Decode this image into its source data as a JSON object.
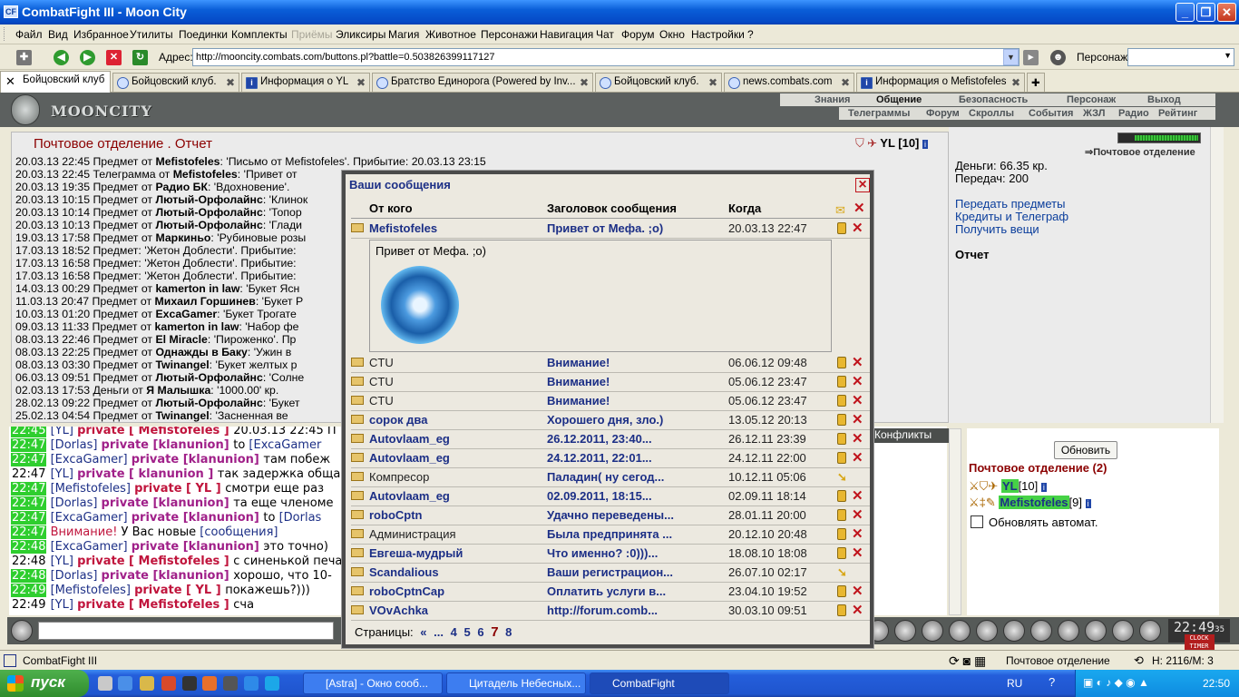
{
  "window": {
    "title": "CombatFight III - Moon City",
    "app_icon": "CF"
  },
  "menu": [
    "Файл",
    "Вид",
    "Избранное",
    "Утилиты",
    "Поединки",
    "Комплекты",
    "Приёмы",
    "Эликсиры",
    "Магия",
    "Животное",
    "Персонажи",
    "Навигация",
    "Чат",
    "Форум",
    "Окно",
    "Настройки",
    "?"
  ],
  "address": {
    "label": "Адрес:",
    "url": "http://mooncity.combats.com/buttons.pl?battle=0.503826399117127",
    "persona_label": "Персонаж:"
  },
  "tabs": [
    "Бойцовский клуб",
    "Бойцовский клуб.",
    "Информация о YL",
    "Братство Единорога (Powered by Inv...",
    "Бойцовский клуб.",
    "news.combats.com",
    "Информация о Mefistofeles"
  ],
  "game_nav": {
    "logo": "MOONCITY",
    "top": [
      "Знания",
      "Общение",
      "Безопасность",
      "Персонаж",
      "Выход"
    ],
    "bottom": [
      "Телеграммы",
      "Форум",
      "Скроллы",
      "События",
      "ЖЗЛ",
      "Радио",
      "Рейтинг"
    ]
  },
  "mail": {
    "title": "Почтовое отделение .   Отчет",
    "user": "YL [10]",
    "log": [
      {
        "pre": "20.03.13 22:45 Предмет от ",
        "who": "Mefistofeles",
        "post": ": 'Письмо от Mefistofeles'. Прибытие: 20.03.13 23:15"
      },
      {
        "pre": "20.03.13 22:45 Телеграмма от ",
        "who": "Mefistofeles",
        "post": ": 'Привет от"
      },
      {
        "pre": "20.03.13 19:35 Предмет от ",
        "who": "Радио БК",
        "post": ": 'Вдохновение'."
      },
      {
        "pre": "20.03.13 10:15 Предмет от ",
        "who": "Лютый-Орфолайнс",
        "post": ": 'Клинок"
      },
      {
        "pre": "20.03.13 10:14 Предмет от ",
        "who": "Лютый-Орфолайнс",
        "post": ": 'Топор"
      },
      {
        "pre": "20.03.13 10:13 Предмет от ",
        "who": "Лютый-Орфолайнс",
        "post": ": 'Глади"
      },
      {
        "pre": "19.03.13 17:58 Предмет от ",
        "who": "Маркиньо",
        "post": ": 'Рубиновые розы"
      },
      {
        "pre": "17.03.13 18:52 Предмет: 'Жетон Доблести'. Прибытие:",
        "who": "",
        "post": ""
      },
      {
        "pre": "17.03.13 16:58 Предмет: 'Жетон Доблести'. Прибытие:",
        "who": "",
        "post": ""
      },
      {
        "pre": "17.03.13 16:58 Предмет: 'Жетон Доблести'. Прибытие:",
        "who": "",
        "post": ""
      },
      {
        "pre": "14.03.13 00:29 Предмет от ",
        "who": "kamerton in law",
        "post": ": 'Букет Ясн"
      },
      {
        "pre": "11.03.13 20:47 Предмет от ",
        "who": "Михаил Горшинев",
        "post": ": 'Букет Р"
      },
      {
        "pre": "10.03.13 01:20 Предмет от ",
        "who": "ExcaGamer",
        "post": ": 'Букет Трогате"
      },
      {
        "pre": "09.03.13 11:33 Предмет от ",
        "who": "kamerton in law",
        "post": ": 'Набор фе"
      },
      {
        "pre": "08.03.13 22:46 Предмет от ",
        "who": "El Miracle",
        "post": ": 'Пироженко'. Пр"
      },
      {
        "pre": "08.03.13 22:25 Предмет от ",
        "who": "Однажды в Баку",
        "post": ": 'Ужин в"
      },
      {
        "pre": "08.03.13 03:30 Предмет от ",
        "who": "Twinangel",
        "post": ": 'Букет желтых р"
      },
      {
        "pre": "06.03.13 09:51 Предмет от ",
        "who": "Лютый-Орфолайнс",
        "post": ": 'Солне"
      },
      {
        "pre": "02.03.13 17:53 Деньги от ",
        "who": "Я Малышка",
        "post": ": '1000.00' кр."
      },
      {
        "pre": "28.02.13 09:22 Предмет от ",
        "who": "Лютый-Орфолайнс",
        "post": ": 'Букет"
      },
      {
        "pre": "25.02.13 04:54 Предмет от ",
        "who": "Twinangel",
        "post": ": 'Засненная ве"
      }
    ]
  },
  "right": {
    "post_link": "Почтовое отделение",
    "money": "Деньги: 66.35 кр.",
    "transfers": "Передач: 200",
    "links": [
      "Передать предметы",
      "Кредиты и Телеграф",
      "Получить вещи"
    ],
    "report": "Отчет"
  },
  "chat": [
    {
      "ts": "22:45",
      "parts": [
        [
          "nm",
          "[YL] "
        ],
        [
          "pv",
          "private [ Mefistofeles ] "
        ],
        [
          "",
          "20.03.13 22:45 П"
        ]
      ]
    },
    {
      "ts": "22:47",
      "parts": [
        [
          "nm",
          "[Dorlas] "
        ],
        [
          "kl",
          "private [klanunion] "
        ],
        [
          "",
          "to "
        ],
        [
          "nm",
          "[ExcaGamer"
        ]
      ]
    },
    {
      "ts": "22:47",
      "parts": [
        [
          "nm",
          "[ExcaGamer] "
        ],
        [
          "kl",
          "private [klanunion] "
        ],
        [
          "",
          "там побеж"
        ]
      ]
    },
    {
      "ts": "22:47",
      "plain": true,
      "parts": [
        [
          "nm",
          "[YL] "
        ],
        [
          "kl",
          "private [ klanunion ] "
        ],
        [
          "",
          "так задержка обща"
        ]
      ]
    },
    {
      "ts": "22:47",
      "parts": [
        [
          "nm",
          "[Mefistofeles] "
        ],
        [
          "pv",
          "private [ YL ] "
        ],
        [
          "",
          "смотри еще раз"
        ]
      ]
    },
    {
      "ts": "22:47",
      "parts": [
        [
          "nm",
          "[Dorlas] "
        ],
        [
          "kl",
          "private [klanunion] "
        ],
        [
          "",
          "та еще членоме"
        ]
      ]
    },
    {
      "ts": "22:47",
      "parts": [
        [
          "nm",
          "[ExcaGamer] "
        ],
        [
          "kl",
          "private [klanunion] "
        ],
        [
          "",
          "to "
        ],
        [
          "nm",
          "[Dorlas"
        ]
      ]
    },
    {
      "ts": "22:47",
      "parts": [
        [
          "warn",
          "Внимание! "
        ],
        [
          "",
          "У Вас новые "
        ],
        [
          "nm",
          "[сообщения]"
        ]
      ]
    },
    {
      "ts": "22:48",
      "parts": [
        [
          "nm",
          "[ExcaGamer] "
        ],
        [
          "kl",
          "private [klanunion] "
        ],
        [
          "",
          "это точно)"
        ]
      ]
    },
    {
      "ts": "22:48",
      "plain": true,
      "parts": [
        [
          "nm",
          "[YL] "
        ],
        [
          "pv",
          "private [ Mefistofeles ] "
        ],
        [
          "",
          "с синенькой печа"
        ]
      ]
    },
    {
      "ts": "22:48",
      "parts": [
        [
          "nm",
          "[Dorlas] "
        ],
        [
          "kl",
          "private [klanunion] "
        ],
        [
          "",
          "хорошо, что 10-"
        ]
      ]
    },
    {
      "ts": "22:49",
      "parts": [
        [
          "nm",
          "[Mefistofeles] "
        ],
        [
          "pv",
          "private [ YL ] "
        ],
        [
          "",
          "покажешь?)))"
        ]
      ]
    },
    {
      "ts": "22:49",
      "plain": true,
      "parts": [
        [
          "nm",
          "[YL] "
        ],
        [
          "pv",
          "private [ Mefistofeles ] "
        ],
        [
          "",
          "сча"
        ]
      ]
    }
  ],
  "conflicts": "Конфликты",
  "rightbottom": {
    "refresh": "Обновить",
    "title": "Почтовое отделение (2)",
    "users": [
      {
        "name": "YL",
        "level": "[10]"
      },
      {
        "name": "Mefistofeles",
        "level": "[9]"
      }
    ],
    "auto": "Обновлять автомат."
  },
  "clock": {
    "time": "22:49",
    "sec": "35",
    "l1": "CLOCK",
    "l2": "TIMER"
  },
  "status": {
    "left": "CombatFight III",
    "middle": "Почтовое отделение",
    "right": "H: 2116/M: 3"
  },
  "taskbar": {
    "start": "пуск",
    "buttons": [
      "[Astra] - Окно сооб...",
      "Цитадель Небесных...",
      "CombatFight"
    ],
    "lang": "RU",
    "time": "22:50"
  },
  "messages": {
    "title": "Ваши сообщения",
    "columns": [
      "От кого",
      "Заголовок сообщения",
      "Когда"
    ],
    "open": {
      "from": "Mefistofeles",
      "subject": "Привет от Мефа. ;o)",
      "when": "20.03.13 22:47",
      "body": "Привет от Мефа. ;o)"
    },
    "rows": [
      {
        "from": "CTU",
        "read": true,
        "subject": "Внимание!",
        "when": "06.06.12 09:48",
        "action": "del"
      },
      {
        "from": "CTU",
        "read": true,
        "subject": "Внимание!",
        "when": "05.06.12 23:47",
        "action": "del"
      },
      {
        "from": "CTU",
        "read": true,
        "subject": "Внимание!",
        "when": "05.06.12 23:47",
        "action": "del"
      },
      {
        "from": "сорок два",
        "read": false,
        "subject": "Хорошего дня, зло.)",
        "when": "13.05.12 20:13",
        "action": "del"
      },
      {
        "from": "Autovlaam_eg",
        "read": false,
        "subject": "26.12.2011, 23:40...",
        "when": "26.12.11 23:39",
        "action": "del"
      },
      {
        "from": "Autovlaam_eg",
        "read": false,
        "subject": "24.12.2011, 22:01...",
        "when": "24.12.11 22:00",
        "action": "del"
      },
      {
        "from": "Компресор",
        "read": true,
        "subject": "Паладин( ну сегод...",
        "when": "10.12.11 05:06",
        "action": "arrow"
      },
      {
        "from": "Autovlaam_eg",
        "read": false,
        "subject": "02.09.2011, 18:15...",
        "when": "02.09.11 18:14",
        "action": "del"
      },
      {
        "from": "roboCptn",
        "read": false,
        "subject": "Удачно переведены...",
        "when": "28.01.11 20:00",
        "action": "del"
      },
      {
        "from": "Администрация",
        "read": true,
        "subject": "Была предпринята ...",
        "when": "20.12.10 20:48",
        "action": "del"
      },
      {
        "from": "Евгеша-мудрый",
        "read": false,
        "subject": "Что именно? :0)))...",
        "when": "18.08.10 18:08",
        "action": "del"
      },
      {
        "from": "Scandalious",
        "read": false,
        "subject": "Ваши регистрацион...",
        "when": "26.07.10 02:17",
        "action": "arrow"
      },
      {
        "from": "roboCptnCap",
        "read": false,
        "subject": "Оплатить услуги в...",
        "when": "23.04.10 19:52",
        "action": "del"
      },
      {
        "from": "VOvAchka",
        "read": false,
        "subject": "http://forum.comb...",
        "when": "30.03.10 09:51",
        "action": "del"
      }
    ],
    "pager": {
      "label": "Страницы:",
      "prev": "«",
      "dots": "...",
      "pages": [
        "4",
        "5",
        "6",
        "7",
        "8"
      ],
      "current": "7"
    }
  }
}
